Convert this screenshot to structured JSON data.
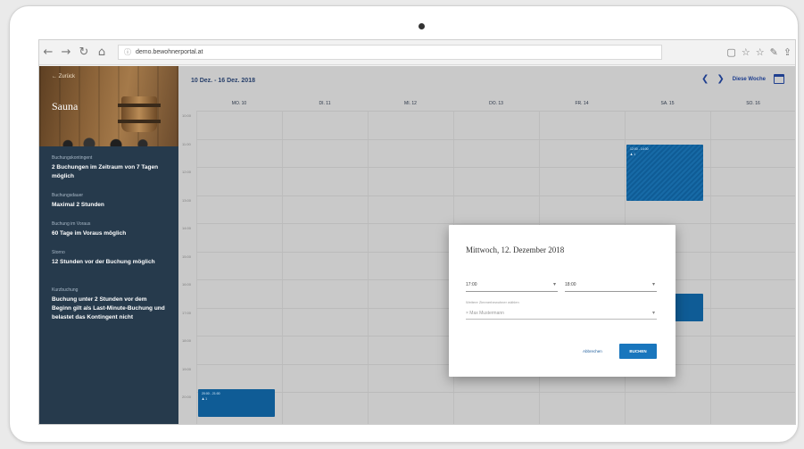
{
  "browser": {
    "url": "demo.bewohnerportal.at"
  },
  "sidebar": {
    "back_label": "← Zurück",
    "title": "Sauna",
    "info": [
      {
        "label": "Buchungskontingent",
        "value": "2 Buchungen im Zeitraum von 7 Tagen möglich"
      },
      {
        "label": "Buchungsdauer",
        "value": "Maximal 2 Stunden"
      },
      {
        "label": "Buchung im Voraus",
        "value": "60 Tage im Voraus möglich"
      },
      {
        "label": "Storno",
        "value": "12 Stunden vor der Buchung möglich"
      },
      {
        "label": "Kurzbuchung",
        "value": "Buchung unter 2 Stunden vor dem Beginn gilt als Last-Minute-Buchung und belastet das Kontingent nicht"
      }
    ]
  },
  "calendar": {
    "range": "10 Dez. - 16 Dez. 2018",
    "this_week_label": "Diese Woche",
    "days": [
      "MO. 10",
      "DI. 11",
      "MI. 12",
      "DO. 13",
      "FR. 14",
      "SA. 15",
      "SO. 16"
    ],
    "hours": [
      "10:00",
      "11:00",
      "12:00",
      "13:00",
      "14:00",
      "15:00",
      "16:00",
      "17:00",
      "18:00",
      "19:00",
      "20:00"
    ],
    "events": [
      {
        "time": "12:00 - 14:00",
        "users": "♟ 1",
        "day": 5,
        "start": 11.2,
        "end": 13.2,
        "striped": true
      },
      {
        "time": "17:00 - 18:00",
        "users": "♟ 1",
        "day": 5,
        "start": 16.5,
        "end": 17.5,
        "striped": false
      },
      {
        "time": "19:00 - 19:30",
        "users": "",
        "day": 3,
        "start": 18.9,
        "end": 19.4,
        "striped": false
      },
      {
        "time": "20:00 - 21:00",
        "users": "♟ 1",
        "day": 0,
        "start": 19.9,
        "end": 20.9,
        "striped": false
      }
    ]
  },
  "modal": {
    "title": "Mittwoch, 12. Dezember 2018",
    "start_time": "17:00",
    "end_time": "18:00",
    "member_label": "Weitere Zimmerbewohner wählen",
    "member_value": "× Max Mustermann",
    "cancel_label": "Abbrechen",
    "book_label": "BUCHEN"
  }
}
